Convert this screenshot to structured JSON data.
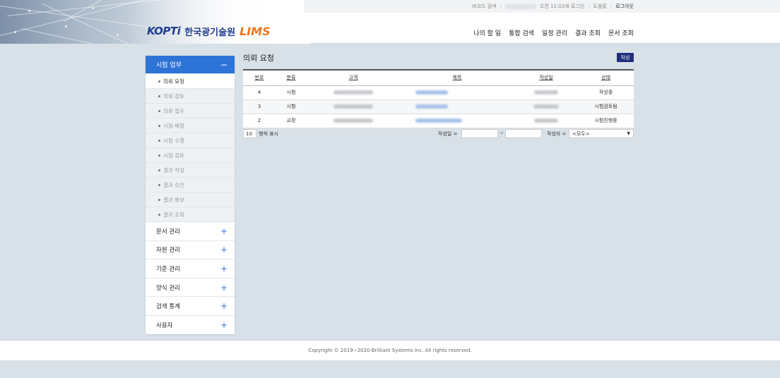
{
  "header": {
    "logo_brand": "KOPTi",
    "logo_org": "한국광기술원",
    "logo_product": "LIMS",
    "util": {
      "barcode": "바코드 검색",
      "login_time": "오전 11:02에 로그인",
      "help": "도움말",
      "logout": "로그아웃"
    },
    "nav": [
      "나의 할 일",
      "통합 검색",
      "일정 관리",
      "결과 조회",
      "문서 조회"
    ]
  },
  "sidebar": {
    "open_section": "시험 업무",
    "sub_items": [
      "의뢰 요청",
      "의뢰 검토",
      "의뢰 접수",
      "시험 배정",
      "시험 수행",
      "시험 검토",
      "결과 작성",
      "결과 승인",
      "결과 통보",
      "결과 조회"
    ],
    "active_index": 0,
    "sections": [
      "문서 관리",
      "자원 관리",
      "기준 관리",
      "양식 관리",
      "검색 통계",
      "사용자"
    ]
  },
  "main": {
    "title": "의뢰 요청",
    "write_button": "작성",
    "columns": [
      "번호",
      "분류",
      "고객",
      "제목",
      "작성일",
      "상태"
    ],
    "rows": [
      {
        "no": "4",
        "category": "시험",
        "status": "작성중"
      },
      {
        "no": "3",
        "category": "시험",
        "status": "시험검토됨"
      },
      {
        "no": "2",
        "category": "교정",
        "status": "시험진행중"
      }
    ],
    "page_size": "10",
    "page_size_label": "행씩 표시",
    "date_filter_label": "작성일 =",
    "date_range_sep": "~",
    "writer_filter_label": "작성자 =",
    "writer_selected": "<모두>"
  },
  "footer": {
    "copyright": "Copyright © 2019~2020 Brilliant Systems Inc. All rights reserved."
  },
  "colors": {
    "accent": "#2e73d6",
    "brand_navy": "#1f3e8e",
    "lims_orange": "#e87722",
    "button_navy": "#1f2f7a",
    "page_bg": "#d8e1e8"
  }
}
